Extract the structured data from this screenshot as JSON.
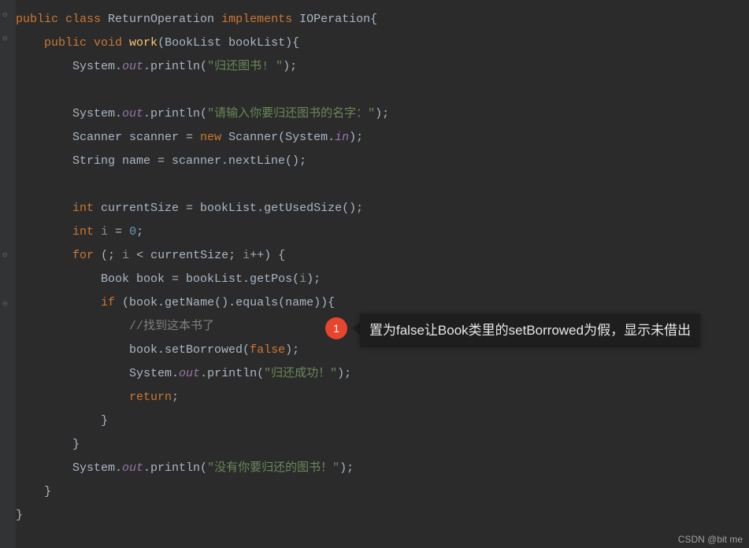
{
  "colors": {
    "bg": "#2b2b2b",
    "keyword": "#cc7832",
    "string": "#6a8759",
    "comment": "#808080",
    "number": "#6897bb",
    "field": "#9876aa",
    "foreground": "#a9b7c6",
    "fn": "#ffc66d",
    "badge": "#e8452f"
  },
  "callout": {
    "number": "1",
    "text": "置为false让Book类里的setBorrowed为假，显示未借出"
  },
  "watermark": "CSDN @bit me",
  "code": {
    "lines": [
      {
        "indent": 0,
        "tokens": [
          [
            "kw",
            "public class "
          ],
          [
            "cls",
            "ReturnOperation "
          ],
          [
            "kw",
            "implements "
          ],
          [
            "cls",
            "IOPeration"
          ],
          [
            "p",
            "{"
          ]
        ]
      },
      {
        "indent": 1,
        "tokens": [
          [
            "kw",
            "public void "
          ],
          [
            "fn",
            "work"
          ],
          [
            "p",
            "("
          ],
          [
            "cls",
            "BookList bookList"
          ],
          [
            "p",
            "){"
          ]
        ]
      },
      {
        "indent": 2,
        "tokens": [
          [
            "cls",
            "System."
          ],
          [
            "fld",
            "out"
          ],
          [
            "p",
            ".println("
          ],
          [
            "str",
            "\"归还图书! \""
          ],
          [
            "p",
            ");"
          ]
        ]
      },
      {
        "indent": 2,
        "tokens": []
      },
      {
        "indent": 2,
        "tokens": [
          [
            "cls",
            "System."
          ],
          [
            "fld",
            "out"
          ],
          [
            "p",
            ".println("
          ],
          [
            "str",
            "\"请输入你要归还图书的名字：\""
          ],
          [
            "p",
            ");"
          ]
        ]
      },
      {
        "indent": 2,
        "tokens": [
          [
            "cls",
            "Scanner scanner = "
          ],
          [
            "kw",
            "new "
          ],
          [
            "cls",
            "Scanner(System."
          ],
          [
            "fld",
            "in"
          ],
          [
            "p",
            ");"
          ]
        ]
      },
      {
        "indent": 2,
        "tokens": [
          [
            "cls",
            "String name = scanner.nextLine();"
          ]
        ]
      },
      {
        "indent": 2,
        "tokens": []
      },
      {
        "indent": 2,
        "tokens": [
          [
            "kw",
            "int "
          ],
          [
            "cls",
            "currentSize = bookList.getUsedSize();"
          ]
        ]
      },
      {
        "indent": 2,
        "tokens": [
          [
            "kw",
            "int "
          ],
          [
            "u",
            "i"
          ],
          [
            "cls",
            " = "
          ],
          [
            "num",
            "0"
          ],
          [
            "p",
            ";"
          ]
        ]
      },
      {
        "indent": 2,
        "tokens": [
          [
            "kw",
            "for "
          ],
          [
            "p",
            "(; "
          ],
          [
            "u",
            "i"
          ],
          [
            "p",
            " < currentSize; "
          ],
          [
            "u",
            "i"
          ],
          [
            "p",
            "++) {"
          ]
        ]
      },
      {
        "indent": 3,
        "tokens": [
          [
            "cls",
            "Book book = bookList.getPos("
          ],
          [
            "u",
            "i"
          ],
          [
            "p",
            ");"
          ]
        ]
      },
      {
        "indent": 3,
        "tokens": [
          [
            "kw",
            "if "
          ],
          [
            "p",
            "(book.getName().equals(name)){"
          ]
        ]
      },
      {
        "indent": 4,
        "tokens": [
          [
            "cmt",
            "//找到这本书了"
          ]
        ]
      },
      {
        "indent": 4,
        "tokens": [
          [
            "cls",
            "book.setBorrowed("
          ],
          [
            "kw",
            "false"
          ],
          [
            "p",
            ");"
          ]
        ]
      },
      {
        "indent": 4,
        "tokens": [
          [
            "cls",
            "System."
          ],
          [
            "fld",
            "out"
          ],
          [
            "p",
            ".println("
          ],
          [
            "str",
            "\"归还成功！\""
          ],
          [
            "p",
            ");"
          ]
        ]
      },
      {
        "indent": 4,
        "tokens": [
          [
            "kw",
            "return"
          ],
          [
            "p",
            ";"
          ]
        ]
      },
      {
        "indent": 3,
        "tokens": [
          [
            "p",
            "}"
          ]
        ]
      },
      {
        "indent": 2,
        "tokens": [
          [
            "p",
            "}"
          ]
        ]
      },
      {
        "indent": 2,
        "tokens": [
          [
            "cls",
            "System."
          ],
          [
            "fld",
            "out"
          ],
          [
            "p",
            ".println("
          ],
          [
            "str",
            "\"没有你要归还的图书！\""
          ],
          [
            "p",
            ");"
          ]
        ]
      },
      {
        "indent": 1,
        "tokens": [
          [
            "p",
            "}"
          ]
        ]
      },
      {
        "indent": 0,
        "tokens": [
          [
            "p",
            "}"
          ]
        ]
      }
    ]
  }
}
